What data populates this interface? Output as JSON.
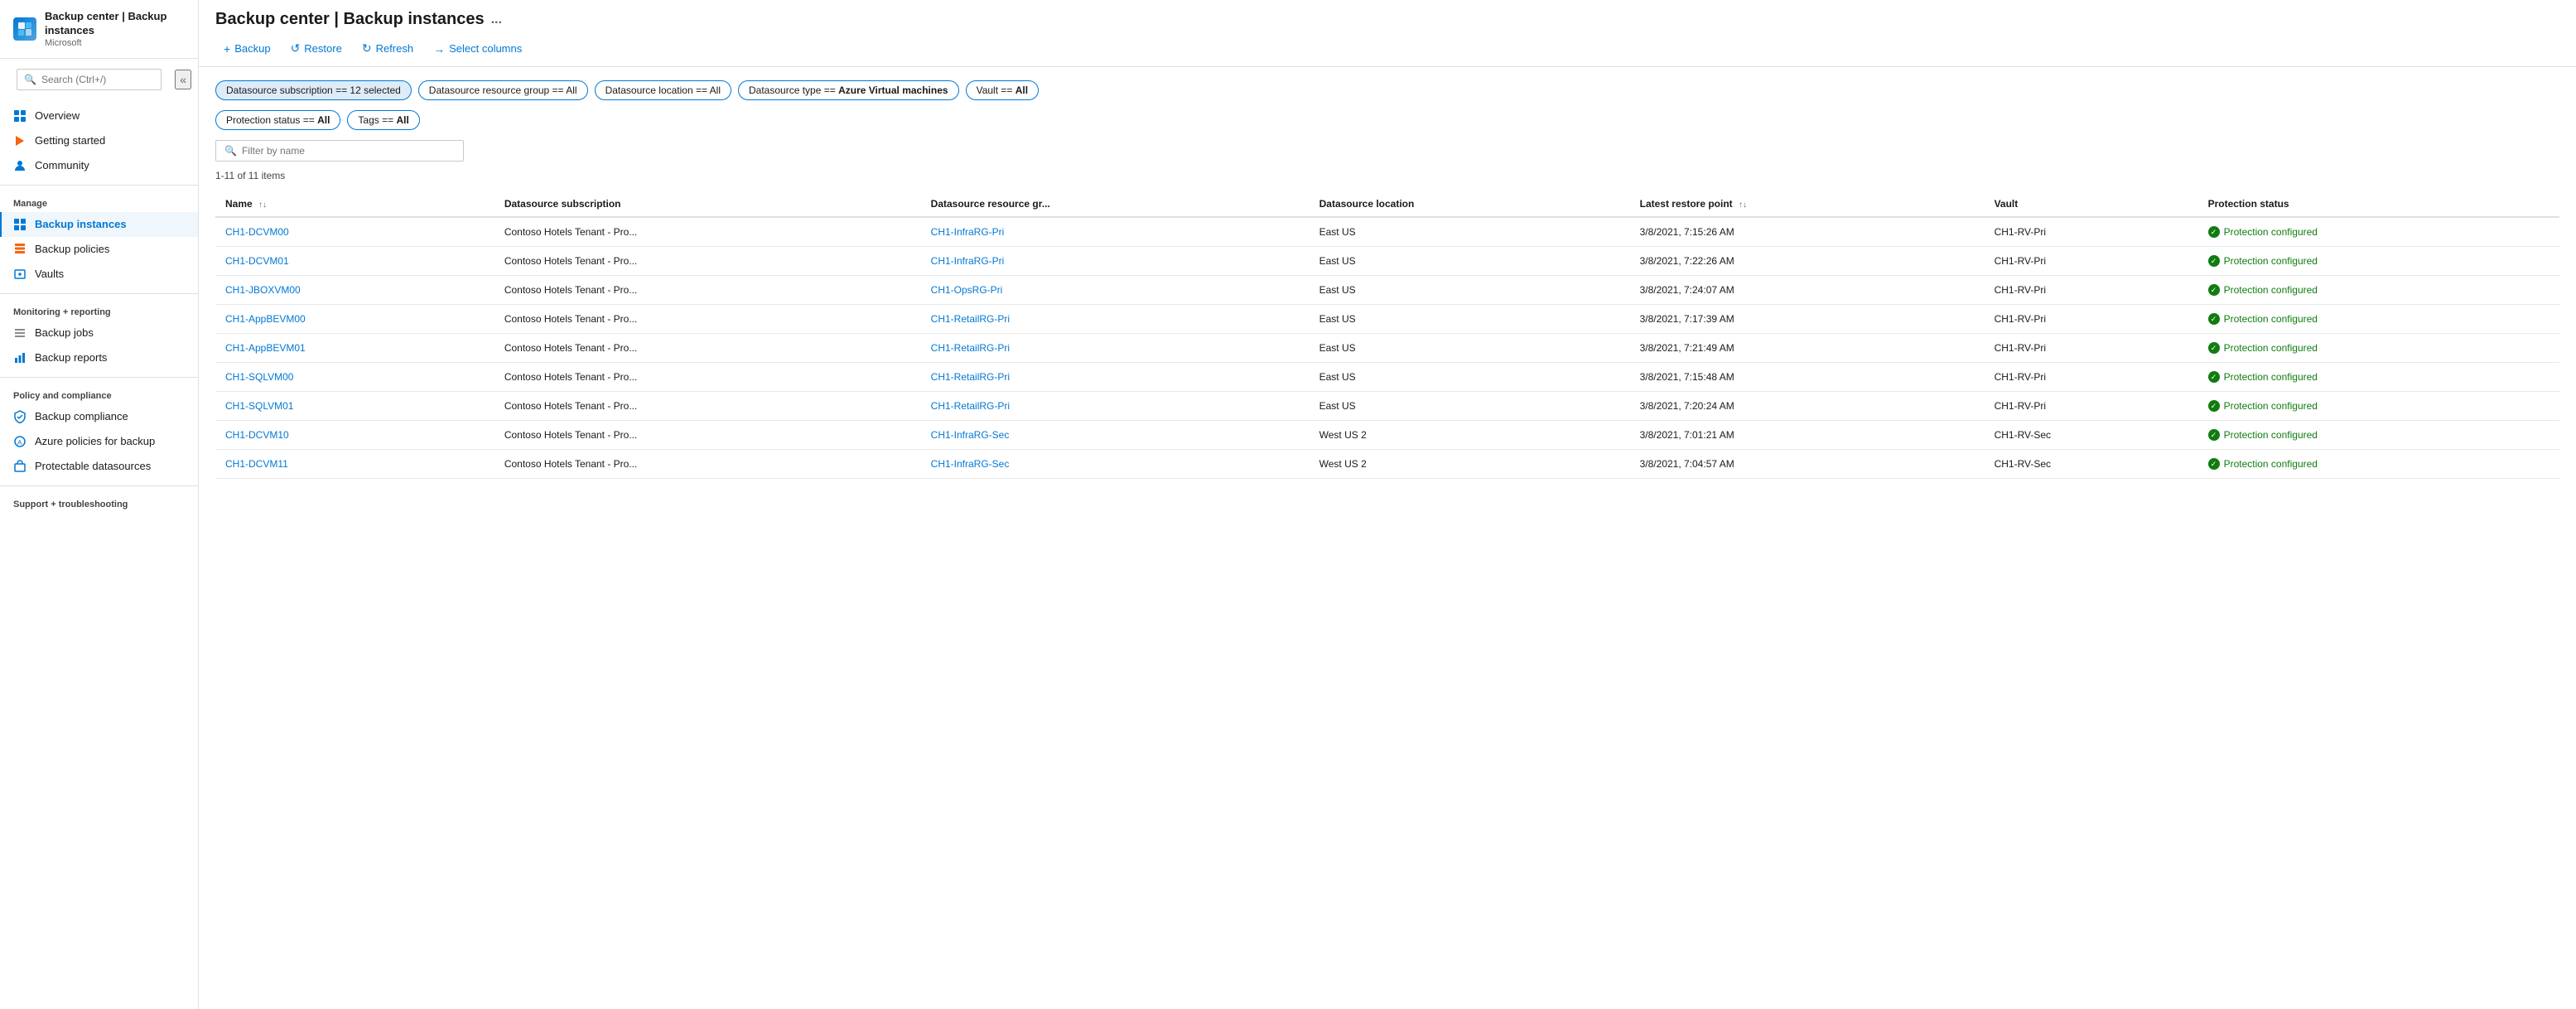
{
  "app": {
    "icon": "☁",
    "title": "Backup center | Backup instances",
    "subtitle": "Microsoft",
    "ellipsis": "..."
  },
  "sidebar": {
    "search_placeholder": "Search (Ctrl+/)",
    "collapse_label": "«",
    "nav_items": [
      {
        "id": "overview",
        "label": "Overview",
        "icon": "⬡",
        "section": null
      },
      {
        "id": "getting-started",
        "label": "Getting started",
        "icon": "▶",
        "section": null
      },
      {
        "id": "community",
        "label": "Community",
        "icon": "☁",
        "section": null
      },
      {
        "id": "manage",
        "label": "Manage",
        "section": "Manage"
      },
      {
        "id": "backup-instances",
        "label": "Backup instances",
        "icon": "⊞",
        "section": "Manage",
        "active": true
      },
      {
        "id": "backup-policies",
        "label": "Backup policies",
        "icon": "⊟",
        "section": "Manage"
      },
      {
        "id": "vaults",
        "label": "Vaults",
        "icon": "☁",
        "section": "Manage"
      },
      {
        "id": "monitoring",
        "label": "Monitoring + reporting",
        "section": "Monitoring + reporting"
      },
      {
        "id": "backup-jobs",
        "label": "Backup jobs",
        "icon": "≡",
        "section": "Monitoring + reporting"
      },
      {
        "id": "backup-reports",
        "label": "Backup reports",
        "icon": "📊",
        "section": "Monitoring + reporting"
      },
      {
        "id": "policy-compliance",
        "label": "Policy and compliance",
        "section": "Policy and compliance"
      },
      {
        "id": "backup-compliance",
        "label": "Backup compliance",
        "icon": "✓",
        "section": "Policy and compliance"
      },
      {
        "id": "azure-policies",
        "label": "Azure policies for backup",
        "icon": "☁",
        "section": "Policy and compliance"
      },
      {
        "id": "protectable",
        "label": "Protectable datasources",
        "icon": "☁",
        "section": "Policy and compliance"
      },
      {
        "id": "support",
        "label": "Support + troubleshooting",
        "section": "Support + troubleshooting"
      }
    ]
  },
  "toolbar": {
    "backup_label": "Backup",
    "restore_label": "Restore",
    "refresh_label": "Refresh",
    "select_columns_label": "Select columns"
  },
  "filters": {
    "datasource_subscription": "Datasource subscription == 12 selected",
    "datasource_resource_group": "Datasource resource group == All",
    "datasource_location": "Datasource location == All",
    "datasource_type": "Datasource type == Azure Virtual machines",
    "vault": "Vault == All",
    "protection_status": "Protection status == All",
    "tags": "Tags == All"
  },
  "filter_by_name_placeholder": "Filter by name",
  "item_count": "1-11 of 11 items",
  "table": {
    "columns": [
      {
        "id": "name",
        "label": "Name",
        "sortable": true
      },
      {
        "id": "datasource_subscription",
        "label": "Datasource subscription",
        "sortable": false
      },
      {
        "id": "datasource_resource_group",
        "label": "Datasource resource gr...",
        "sortable": false
      },
      {
        "id": "datasource_location",
        "label": "Datasource location",
        "sortable": false
      },
      {
        "id": "latest_restore_point",
        "label": "Latest restore point",
        "sortable": true
      },
      {
        "id": "vault",
        "label": "Vault",
        "sortable": false
      },
      {
        "id": "protection_status",
        "label": "Protection status",
        "sortable": false
      }
    ],
    "rows": [
      {
        "name": "CH1-DCVM00",
        "subscription": "Contoso Hotels Tenant - Pro...",
        "resource_group": "CH1-InfraRG-Pri",
        "location": "East US",
        "restore_point": "3/8/2021, 7:15:26 AM",
        "vault": "CH1-RV-Pri",
        "status": "Protection configured"
      },
      {
        "name": "CH1-DCVM01",
        "subscription": "Contoso Hotels Tenant - Pro...",
        "resource_group": "CH1-InfraRG-Pri",
        "location": "East US",
        "restore_point": "3/8/2021, 7:22:26 AM",
        "vault": "CH1-RV-Pri",
        "status": "Protection configured"
      },
      {
        "name": "CH1-JBOXVM00",
        "subscription": "Contoso Hotels Tenant - Pro...",
        "resource_group": "CH1-OpsRG-Pri",
        "location": "East US",
        "restore_point": "3/8/2021, 7:24:07 AM",
        "vault": "CH1-RV-Pri",
        "status": "Protection configured"
      },
      {
        "name": "CH1-AppBEVM00",
        "subscription": "Contoso Hotels Tenant - Pro...",
        "resource_group": "CH1-RetailRG-Pri",
        "location": "East US",
        "restore_point": "3/8/2021, 7:17:39 AM",
        "vault": "CH1-RV-Pri",
        "status": "Protection configured"
      },
      {
        "name": "CH1-AppBEVM01",
        "subscription": "Contoso Hotels Tenant - Pro...",
        "resource_group": "CH1-RetailRG-Pri",
        "location": "East US",
        "restore_point": "3/8/2021, 7:21:49 AM",
        "vault": "CH1-RV-Pri",
        "status": "Protection configured"
      },
      {
        "name": "CH1-SQLVM00",
        "subscription": "Contoso Hotels Tenant - Pro...",
        "resource_group": "CH1-RetailRG-Pri",
        "location": "East US",
        "restore_point": "3/8/2021, 7:15:48 AM",
        "vault": "CH1-RV-Pri",
        "status": "Protection configured"
      },
      {
        "name": "CH1-SQLVM01",
        "subscription": "Contoso Hotels Tenant - Pro...",
        "resource_group": "CH1-RetailRG-Pri",
        "location": "East US",
        "restore_point": "3/8/2021, 7:20:24 AM",
        "vault": "CH1-RV-Pri",
        "status": "Protection configured"
      },
      {
        "name": "CH1-DCVM10",
        "subscription": "Contoso Hotels Tenant - Pro...",
        "resource_group": "CH1-InfraRG-Sec",
        "location": "West US 2",
        "restore_point": "3/8/2021, 7:01:21 AM",
        "vault": "CH1-RV-Sec",
        "status": "Protection configured"
      },
      {
        "name": "CH1-DCVM11",
        "subscription": "Contoso Hotels Tenant - Pro...",
        "resource_group": "CH1-InfraRG-Sec",
        "location": "West US 2",
        "restore_point": "3/8/2021, 7:04:57 AM",
        "vault": "CH1-RV-Sec",
        "status": "Protection configured"
      }
    ]
  }
}
